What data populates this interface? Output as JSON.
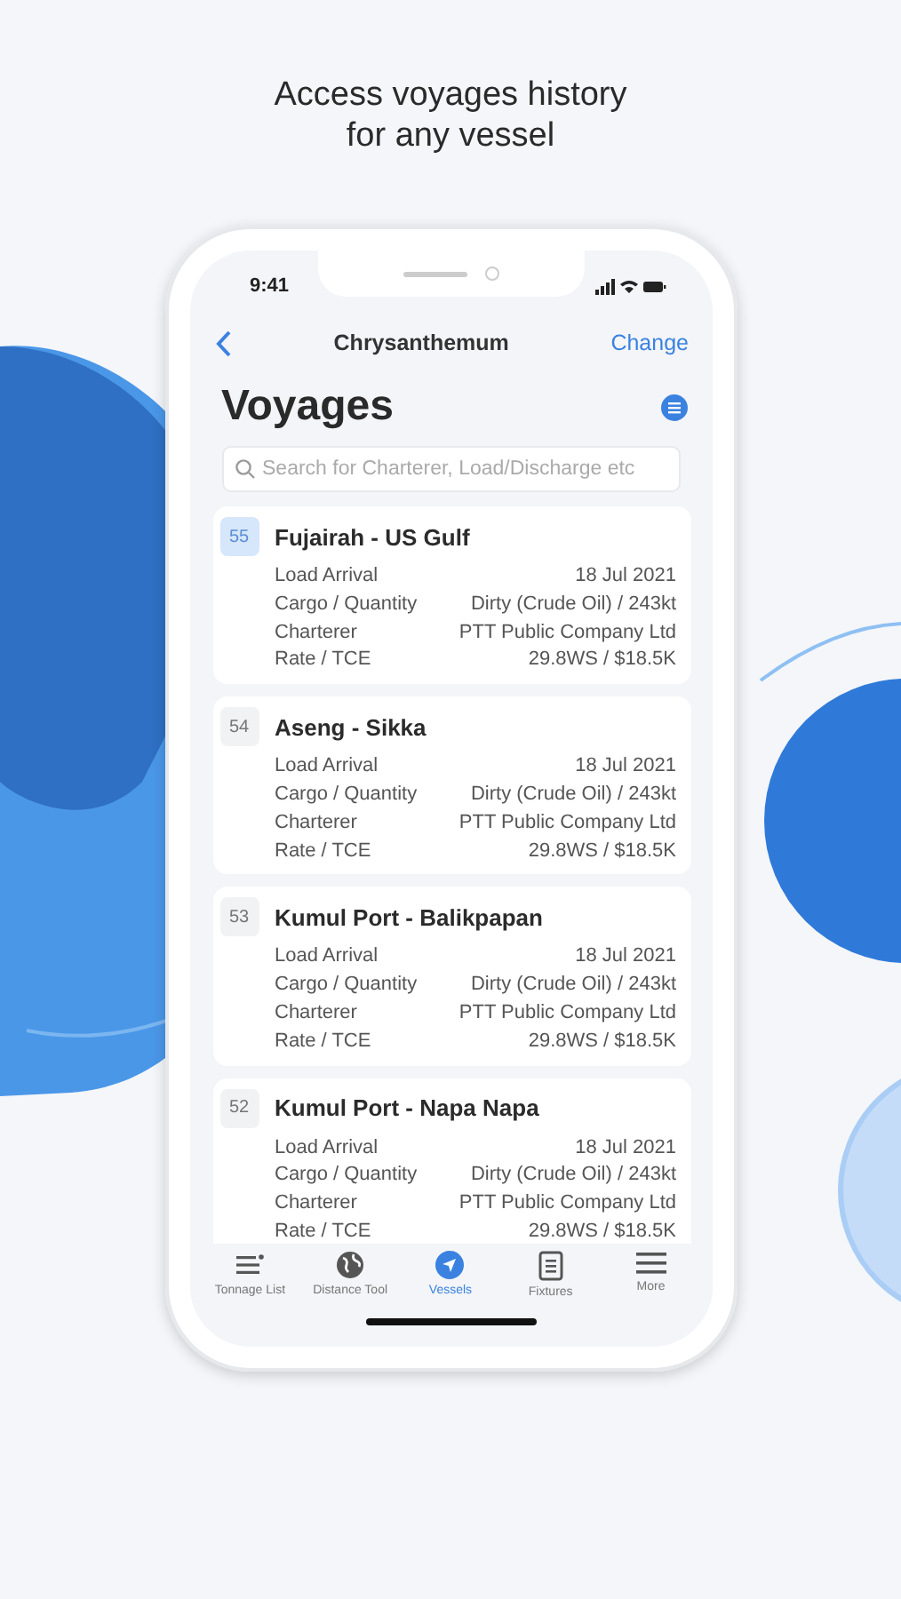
{
  "headline": "Access voyages history for any vessel",
  "status_bar": {
    "time": "9:41"
  },
  "nav": {
    "title": "Chrysanthemum",
    "action": "Change"
  },
  "page_title": "Voyages",
  "search": {
    "placeholder": "Search for Charterer, Load/Discharge etc"
  },
  "voyages": [
    {
      "number": "55",
      "route": "Fujairah - US Gulf",
      "selected": true,
      "fields": [
        {
          "label": "Load Arrival",
          "value": "18 Jul 2021"
        },
        {
          "label": "Cargo / Quantity",
          "value": "Dirty (Crude Oil) / 243kt"
        },
        {
          "label": "Charterer",
          "value": "PTT Public Company Ltd"
        },
        {
          "label": "Rate / TCE",
          "value": "29.8WS / $18.5K"
        }
      ]
    },
    {
      "number": "54",
      "route": "Aseng - Sikka",
      "selected": false,
      "fields": [
        {
          "label": "Load Arrival",
          "value": "18 Jul 2021"
        },
        {
          "label": "Cargo / Quantity",
          "value": "Dirty (Crude Oil) / 243kt"
        },
        {
          "label": "Charterer",
          "value": "PTT Public Company Ltd"
        },
        {
          "label": "Rate / TCE",
          "value": "29.8WS / $18.5K"
        }
      ]
    },
    {
      "number": "53",
      "route": "Kumul Port - Balikpapan",
      "selected": false,
      "fields": [
        {
          "label": "Load Arrival",
          "value": "18 Jul 2021"
        },
        {
          "label": "Cargo / Quantity",
          "value": "Dirty (Crude Oil) / 243kt"
        },
        {
          "label": "Charterer",
          "value": "PTT Public Company Ltd"
        },
        {
          "label": "Rate / TCE",
          "value": "29.8WS / $18.5K"
        }
      ]
    },
    {
      "number": "52",
      "route": "Kumul Port - Napa Napa",
      "selected": false,
      "fields": [
        {
          "label": "Load Arrival",
          "value": "18 Jul 2021"
        },
        {
          "label": "Cargo / Quantity",
          "value": "Dirty (Crude Oil) / 243kt"
        },
        {
          "label": "Charterer",
          "value": "PTT Public Company Ltd"
        },
        {
          "label": "Rate / TCE",
          "value": "29.8WS / $18.5K"
        }
      ]
    }
  ],
  "tabs": [
    {
      "label": "Tonnage List",
      "kind": "list",
      "selected": false
    },
    {
      "label": "Distance Tool",
      "kind": "globe",
      "selected": false
    },
    {
      "label": "Vessels",
      "kind": "compass",
      "selected": true
    },
    {
      "label": "Fixtures",
      "kind": "document",
      "selected": false
    },
    {
      "label": "More",
      "kind": "menu",
      "selected": false
    }
  ]
}
